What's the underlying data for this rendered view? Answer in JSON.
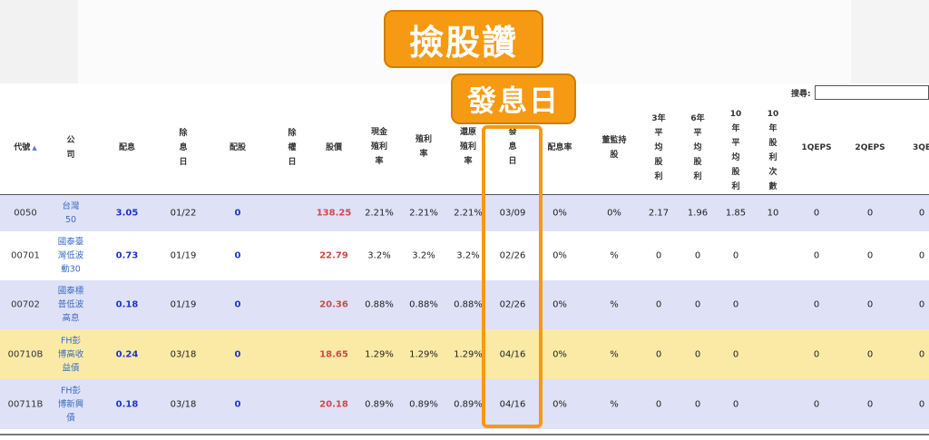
{
  "banner": {
    "title": "撿股讚",
    "subtitle": "發息日"
  },
  "search": {
    "label": "搜尋:",
    "value": ""
  },
  "columns": [
    {
      "key": "code",
      "label": "代號",
      "sort": "▲"
    },
    {
      "key": "name",
      "label": "公\n司"
    },
    {
      "key": "div",
      "label": "配息"
    },
    {
      "key": "exdate",
      "label": "除\n息\n日"
    },
    {
      "key": "stockdiv",
      "label": "配股"
    },
    {
      "key": "exright",
      "label": "除\n權\n日"
    },
    {
      "key": "price",
      "label": "股價"
    },
    {
      "key": "cashyield",
      "label": "現金\n殖利\n率"
    },
    {
      "key": "yield",
      "label": "殖利\n率"
    },
    {
      "key": "restoreyield",
      "label": "還原\n殖利\n率"
    },
    {
      "key": "paydate",
      "label": "發\n息\n日"
    },
    {
      "key": "payratio",
      "label": "配息率"
    },
    {
      "key": "board",
      "label": "董監持\n股"
    },
    {
      "key": "avg3",
      "label": "3年\n平\n均\n股\n利"
    },
    {
      "key": "avg6",
      "label": "6年\n平\n均\n股\n利"
    },
    {
      "key": "avg10",
      "label": "10\n年\n平\n均\n股\n利"
    },
    {
      "key": "count10",
      "label": "10\n年\n股\n利\n次\n數"
    },
    {
      "key": "q1eps",
      "label": "1QEPS"
    },
    {
      "key": "q2eps",
      "label": "2QEPS"
    },
    {
      "key": "q3eps",
      "label": "3QE"
    }
  ],
  "rows": [
    {
      "bg": "#dfe1f7",
      "code": "0050",
      "name": "台灣\n50",
      "div": "3.05",
      "exdate": "01/22",
      "stockdiv": "0",
      "exright": "",
      "price": "138.25",
      "cashyield": "2.21%",
      "yield": "2.21%",
      "restoreyield": "2.21%",
      "paydate": "03/09",
      "payratio": "0%",
      "board": "0%",
      "avg3": "2.17",
      "avg6": "1.96",
      "avg10": "1.85",
      "count10": "10",
      "q1eps": "0",
      "q2eps": "0",
      "q3eps": "0"
    },
    {
      "bg": "#ffffff",
      "code": "00701",
      "name": "國泰臺\n灣低波\n動30",
      "div": "0.73",
      "exdate": "01/19",
      "stockdiv": "0",
      "exright": "",
      "price": "22.79",
      "cashyield": "3.2%",
      "yield": "3.2%",
      "restoreyield": "3.2%",
      "paydate": "02/26",
      "payratio": "0%",
      "board": "%",
      "avg3": "0",
      "avg6": "0",
      "avg10": "0",
      "count10": "",
      "q1eps": "0",
      "q2eps": "0",
      "q3eps": "0"
    },
    {
      "bg": "#dfe1f7",
      "code": "00702",
      "name": "國泰標\n普低波\n高息",
      "div": "0.18",
      "exdate": "01/19",
      "stockdiv": "0",
      "exright": "",
      "price": "20.36",
      "cashyield": "0.88%",
      "yield": "0.88%",
      "restoreyield": "0.88%",
      "paydate": "02/26",
      "payratio": "0%",
      "board": "%",
      "avg3": "0",
      "avg6": "0",
      "avg10": "0",
      "count10": "",
      "q1eps": "0",
      "q2eps": "0",
      "q3eps": "0"
    },
    {
      "bg": "#fbeaa6",
      "code": "00710B",
      "name": "FH彭\n博高收\n益債",
      "div": "0.24",
      "exdate": "03/18",
      "stockdiv": "0",
      "exright": "",
      "price": "18.65",
      "cashyield": "1.29%",
      "yield": "1.29%",
      "restoreyield": "1.29%",
      "paydate": "04/16",
      "payratio": "0%",
      "board": "%",
      "avg3": "0",
      "avg6": "0",
      "avg10": "0",
      "count10": "",
      "q1eps": "0",
      "q2eps": "0",
      "q3eps": "0"
    },
    {
      "bg": "#dfe1f7",
      "code": "00711B",
      "name": "FH彭\n博新興\n債",
      "div": "0.18",
      "exdate": "03/18",
      "stockdiv": "0",
      "exright": "",
      "price": "20.18",
      "cashyield": "0.89%",
      "yield": "0.89%",
      "restoreyield": "0.89%",
      "paydate": "04/16",
      "payratio": "0%",
      "board": "%",
      "avg3": "0",
      "avg6": "0",
      "avg10": "0",
      "count10": "",
      "q1eps": "0",
      "q2eps": "0",
      "q3eps": "0"
    }
  ]
}
